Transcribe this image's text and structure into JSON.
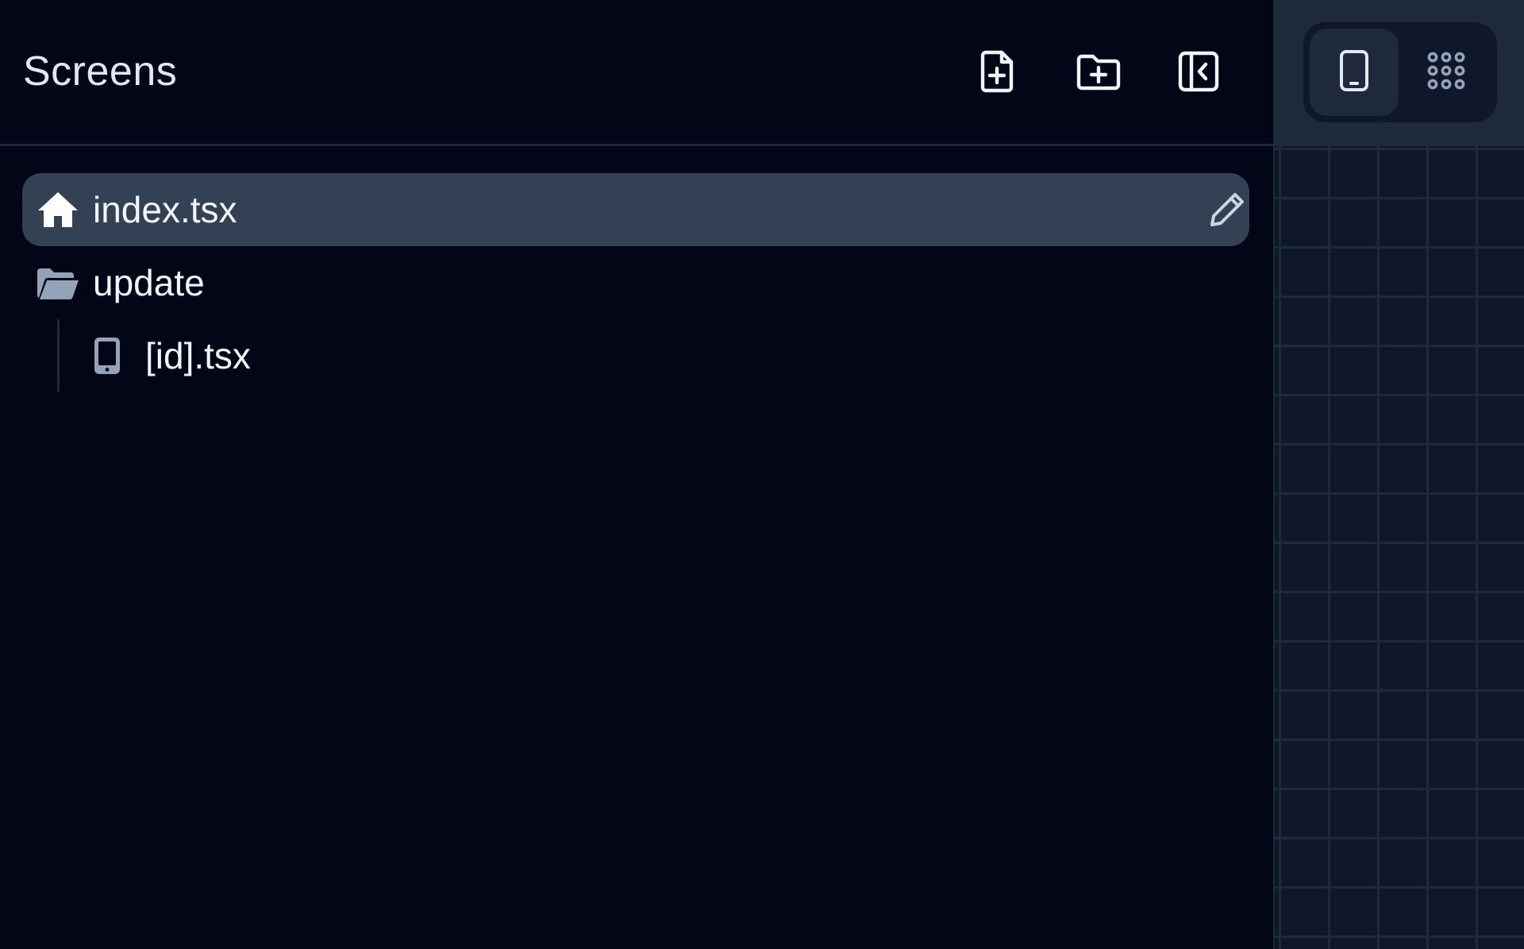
{
  "sidebar": {
    "title": "Screens",
    "actions": [
      {
        "name": "new-file-button",
        "icon": "file-plus-icon"
      },
      {
        "name": "new-folder-button",
        "icon": "folder-plus-icon"
      },
      {
        "name": "collapse-sidebar-button",
        "icon": "panel-collapse-icon"
      }
    ]
  },
  "tree": {
    "items": [
      {
        "label": "index.tsx",
        "icon": "home-icon",
        "selected": true,
        "trailing_icon": "pencil-icon"
      },
      {
        "label": "update",
        "icon": "folder-open-icon",
        "children": [
          {
            "label": "[id].tsx",
            "icon": "phone-icon"
          }
        ]
      }
    ]
  },
  "view_toggle": {
    "options": [
      {
        "name": "single-view",
        "icon": "phone-icon",
        "active": true
      },
      {
        "name": "grid-view",
        "icon": "grid-icon",
        "active": false
      }
    ]
  },
  "colors": {
    "background": "#020617",
    "selected_row": "#334155",
    "border": "#1e293b",
    "text": "#f1f5f9",
    "muted_icon": "#94a3b8",
    "canvas": "#0f172a"
  }
}
